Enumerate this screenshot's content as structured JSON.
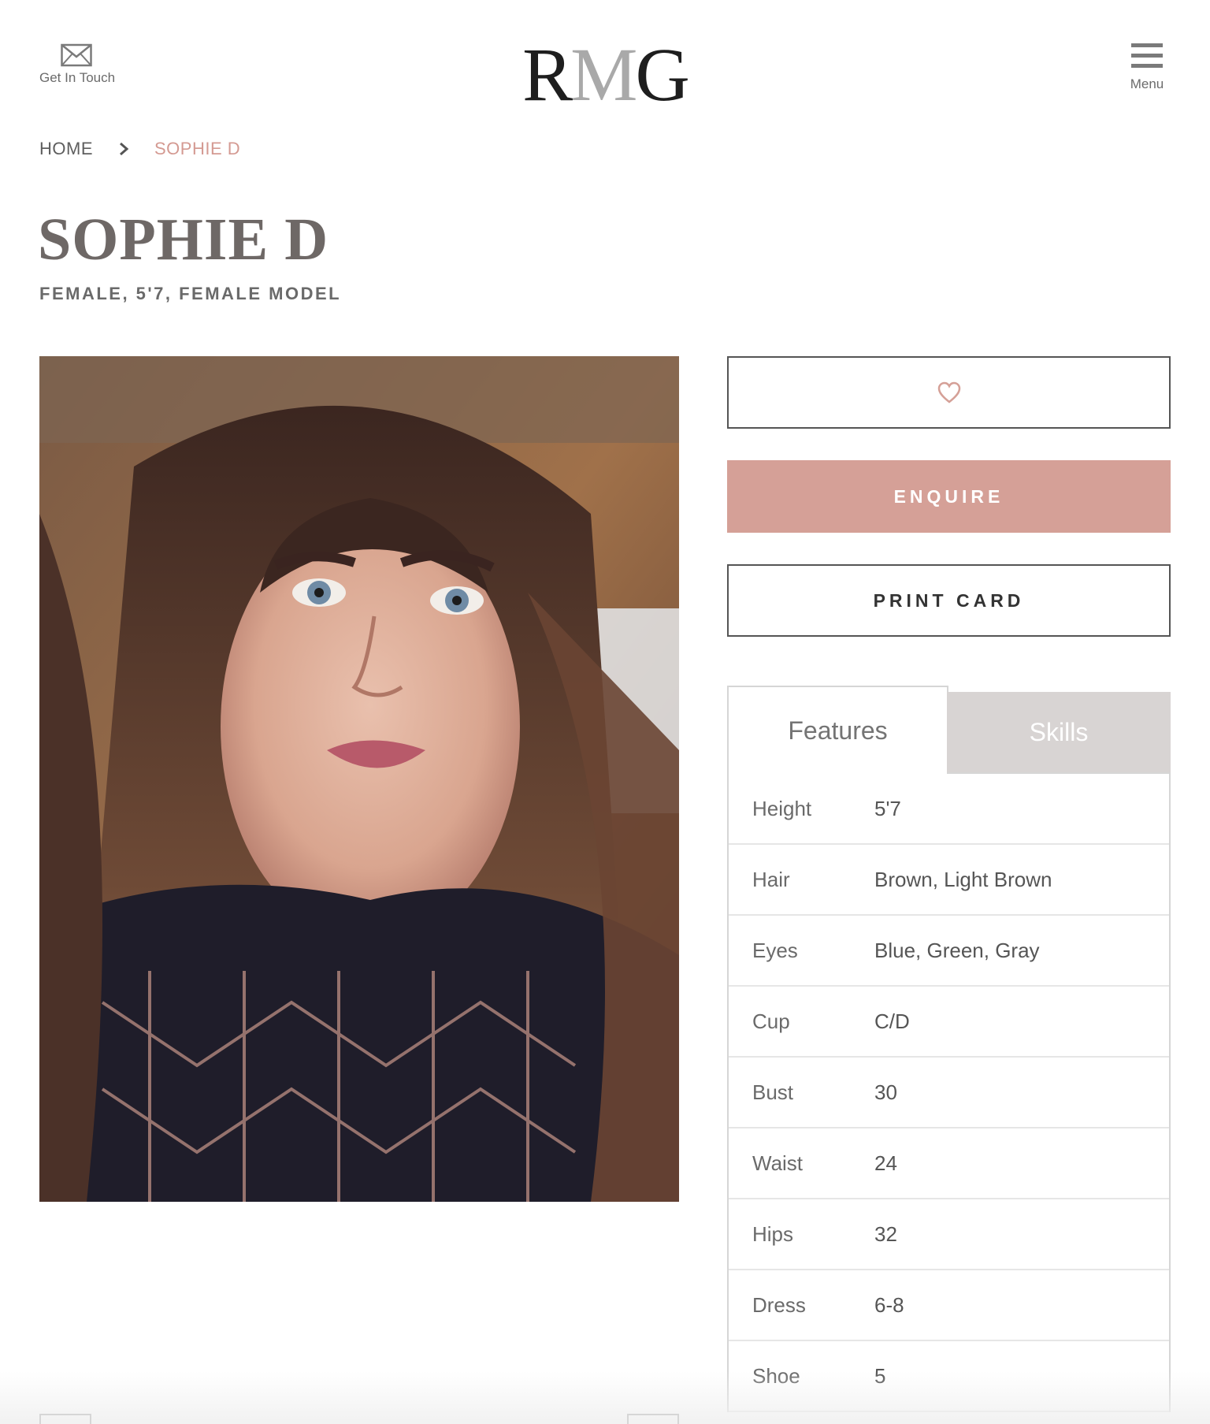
{
  "header": {
    "contact_label": "Get In Touch",
    "logo_text_r": "R",
    "logo_text_m": "M",
    "logo_text_g": "G",
    "menu_label": "Menu"
  },
  "breadcrumb": {
    "home": "HOME",
    "current": "SOPHIE D"
  },
  "profile": {
    "name": "SOPHIE D",
    "subtitle": "FEMALE, 5'7, FEMALE MODEL"
  },
  "actions": {
    "enquire_label": "ENQUIRE",
    "print_label": "PRINT CARD"
  },
  "tabs": {
    "features": "Features",
    "skills": "Skills"
  },
  "features": [
    {
      "key": "Height",
      "value": "5'7"
    },
    {
      "key": "Hair",
      "value": "Brown, Light Brown"
    },
    {
      "key": "Eyes",
      "value": "Blue, Green, Gray"
    },
    {
      "key": "Cup",
      "value": "C/D"
    },
    {
      "key": "Bust",
      "value": "30"
    },
    {
      "key": "Waist",
      "value": "24"
    },
    {
      "key": "Hips",
      "value": "32"
    },
    {
      "key": "Dress",
      "value": "6-8"
    },
    {
      "key": "Shoe",
      "value": "5"
    }
  ],
  "colors": {
    "accent": "#d5a097",
    "breadcrumb_current": "#d49a92",
    "tab_inactive": "#d8d4d3"
  },
  "icons": {
    "contact": "envelope-icon",
    "menu": "hamburger-icon",
    "separator": "chevron-right-icon",
    "favorite": "heart-icon"
  }
}
